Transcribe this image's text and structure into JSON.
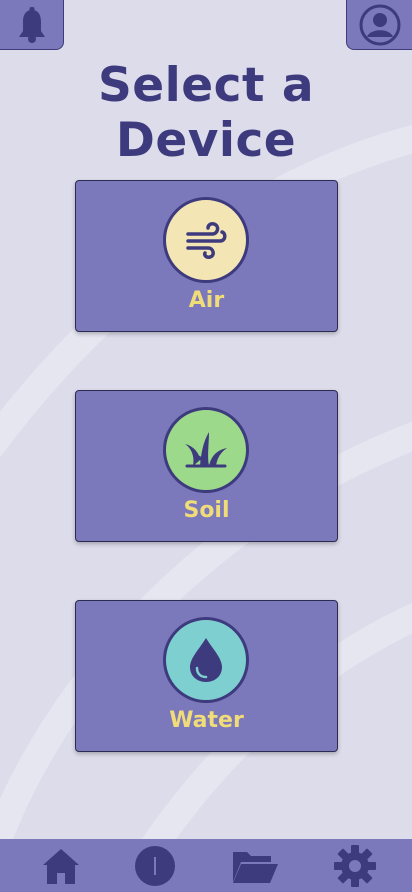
{
  "header": {
    "title": "Select a Device"
  },
  "topbar": {
    "left_icon": "bell-icon",
    "right_icon": "profile-icon"
  },
  "devices": [
    {
      "label": "Air",
      "icon": "wind-icon",
      "icon_bg": "#f4e6b4"
    },
    {
      "label": "Soil",
      "icon": "grass-icon",
      "icon_bg": "#9cd98a"
    },
    {
      "label": "Water",
      "icon": "water-drop-icon",
      "icon_bg": "#7ecfd0"
    }
  ],
  "bottom_nav": [
    {
      "name": "home",
      "icon": "home-icon"
    },
    {
      "name": "info",
      "icon": "info-icon"
    },
    {
      "name": "files",
      "icon": "folder-icon"
    },
    {
      "name": "settings",
      "icon": "gear-icon"
    }
  ],
  "colors": {
    "background": "#dcdcea",
    "primary": "#7b78bb",
    "dark": "#3e3a7e",
    "accent": "#f0dc78"
  }
}
